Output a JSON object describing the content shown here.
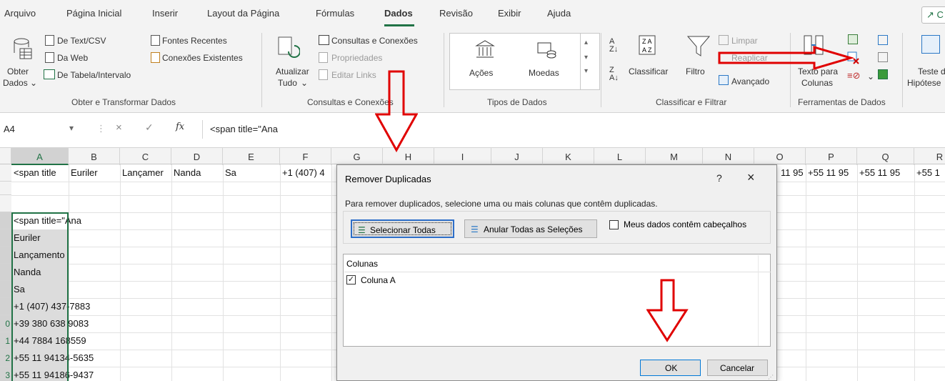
{
  "menu": {
    "tabs": [
      "Arquivo",
      "Página Inicial",
      "Inserir",
      "Layout da Página",
      "Fórmulas",
      "Dados",
      "Revisão",
      "Exibir",
      "Ajuda"
    ],
    "active": "Dados",
    "share_label": "C"
  },
  "ribbon": {
    "get_data": {
      "obter_dados_1": "Obter",
      "obter_dados_2": "Dados",
      "de_texto_csv": "De Text/CSV",
      "da_web": "Da Web",
      "de_tabela": "De Tabela/Intervalo",
      "fontes_recentes": "Fontes Recentes",
      "conexoes_existentes": "Conexões Existentes",
      "group_label": "Obter e Transformar Dados"
    },
    "queries": {
      "atualizar_1": "Atualizar",
      "atualizar_2": "Tudo",
      "consultas_conexoes": "Consultas e Conexões",
      "propriedades": "Propriedades",
      "editar_links": "Editar Links",
      "group_label": "Consultas e Conexões"
    },
    "data_types": {
      "acoes": "Ações",
      "moedas": "Moedas",
      "group_label": "Tipos de Dados"
    },
    "sort_filter": {
      "classificar": "Classificar",
      "filtro": "Filtro",
      "limpar": "Limpar",
      "reaplicar": "Reaplicar",
      "avancado": "Avançado",
      "group_label": "Classificar e Filtrar"
    },
    "data_tools": {
      "texto_para_1": "Texto para",
      "texto_para_2": "Colunas",
      "group_label": "Ferramentas de Dados"
    },
    "forecast": {
      "teste_1": "Teste d",
      "teste_2": "Hipótese"
    }
  },
  "formula_bar": {
    "name_box": "A4",
    "fx": "fx",
    "value": "<span title=\"Ana"
  },
  "sheet": {
    "columns": [
      "A",
      "B",
      "C",
      "D",
      "E",
      "F",
      "G",
      "H",
      "I",
      "J",
      "K",
      "L",
      "M",
      "N",
      "O",
      "P",
      "Q",
      "R"
    ],
    "row_numbers": [
      "",
      "",
      "",
      "",
      "",
      "",
      "",
      "",
      "",
      "0",
      "1",
      "2",
      "3"
    ],
    "row1": {
      "A": "<span title",
      "B": "Euriler",
      "C": "Lançamer",
      "D": "Nanda",
      "E": "Sa",
      "F": "+1 (407) 4",
      "O": "11 95",
      "P": "+55 11 95",
      "Q": "+55 11 95",
      "R": "+55 1"
    },
    "colA": [
      "<span title=\"Ana",
      "Euriler",
      "Lançamento",
      "Nanda",
      "Sa",
      "+1 (407) 437-7883",
      "+39 380 638 9083",
      "+44 7884 168559",
      "+55 11 94134-5635",
      "+55 11 94186-9437"
    ]
  },
  "dialog": {
    "title": "Remover Duplicadas",
    "help": "?",
    "close": "×",
    "instructions": "Para remover duplicados, selecione uma ou mais colunas que contêm duplicadas.",
    "select_all": "Selecionar Todas",
    "unselect_all": "Anular Todas as Seleções",
    "has_headers": "Meus dados contêm cabeçalhos",
    "columns_header": "Colunas",
    "column_item": "Coluna A",
    "ok": "OK",
    "cancel": "Cancelar"
  },
  "colors": {
    "excel_green": "#217346",
    "arrow_red": "#e00000",
    "focus_blue": "#2d6ec8"
  }
}
